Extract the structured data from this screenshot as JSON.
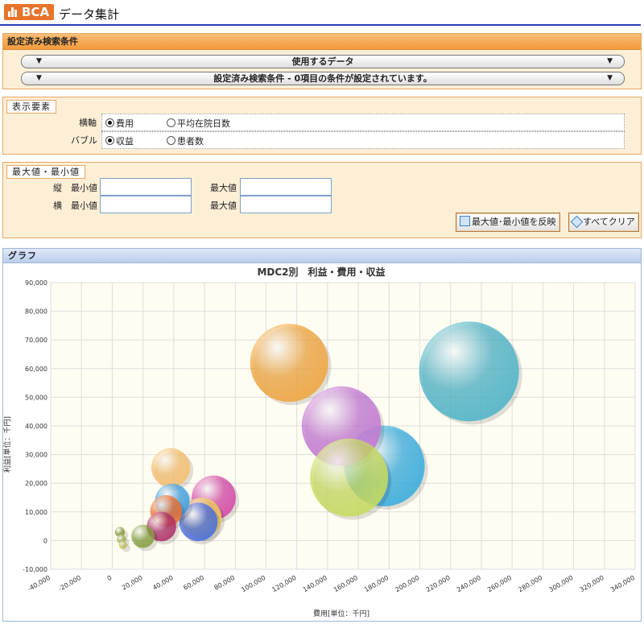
{
  "header": {
    "logo_text": "BCA",
    "title": "データ集計",
    "accent": "#e8742a",
    "rule_color": "#2a3fb8"
  },
  "search_panel": {
    "title": "設定済み検索条件",
    "data_bar": {
      "label": "使用するデータ",
      "arrow": "▼"
    },
    "condition_bar": {
      "label": "設定済み検索条件 - 0項目の条件が設定されています。",
      "arrow": "▼"
    }
  },
  "display_panel": {
    "title": "表示要素",
    "xaxis": {
      "label": "横軸",
      "options": [
        "費用",
        "平均在院日数"
      ],
      "selected": "費用"
    },
    "bubble": {
      "label": "バブル",
      "options": [
        "収益",
        "患者数"
      ],
      "selected": "収益"
    }
  },
  "minmax_panel": {
    "title": "最大値・最小値",
    "vertical": {
      "label": "縦",
      "min_label": "最小値",
      "max_label": "最大値",
      "min_value": "",
      "max_value": ""
    },
    "horizontal": {
      "label": "横",
      "min_label": "最小値",
      "max_label": "最大値",
      "min_value": "",
      "max_value": ""
    },
    "apply_button": "最大値･最小値を反映",
    "clear_button": "すべてクリア"
  },
  "graph_panel": {
    "title": "グラフ"
  },
  "chart_data": {
    "type": "scatter",
    "title": "MDC2別　利益・費用・収益",
    "xlabel": "費用[単位：千円]",
    "ylabel": "利益[単位：千円]",
    "xlim": [
      -40000,
      340000
    ],
    "ylim": [
      -10000,
      90000
    ],
    "xticks": [
      "-40,000",
      "-20,000",
      "0",
      "20,000",
      "40,000",
      "60,000",
      "80,000",
      "100,000",
      "120,000",
      "140,000",
      "160,000",
      "180,000",
      "200,000",
      "220,000",
      "240,000",
      "260,000",
      "280,000",
      "300,000",
      "320,000",
      "340,000"
    ],
    "yticks": [
      "-10,000",
      "0",
      "10,000",
      "20,000",
      "30,000",
      "40,000",
      "50,000",
      "60,000",
      "70,000",
      "80,000",
      "90,000"
    ],
    "grid": true,
    "bubbles": [
      {
        "x": 232000,
        "y": 59000,
        "size": 298000,
        "color": "#4fb5c9"
      },
      {
        "x": 115000,
        "y": 62000,
        "size": 182000,
        "color": "#f0a640"
      },
      {
        "x": 177000,
        "y": 26000,
        "size": 194000,
        "color": "#3aaee0"
      },
      {
        "x": 149000,
        "y": 40000,
        "size": 188000,
        "color": "#c478d4"
      },
      {
        "x": 154000,
        "y": 22000,
        "size": 182000,
        "color": "#c8dc60"
      },
      {
        "x": 66000,
        "y": 15000,
        "size": 58000,
        "color": "#d64aa8"
      },
      {
        "x": 58000,
        "y": 8000,
        "size": 48000,
        "color": "#f2d060"
      },
      {
        "x": 56000,
        "y": 6500,
        "size": 44000,
        "color": "#4a6fe0"
      },
      {
        "x": 38000,
        "y": 25500,
        "size": 45000,
        "color": "#f5c070"
      },
      {
        "x": 39000,
        "y": 13800,
        "size": 36000,
        "color": "#3f9fe0"
      },
      {
        "x": 35000,
        "y": 10300,
        "size": 30000,
        "color": "#f07030"
      },
      {
        "x": 32000,
        "y": 4900,
        "size": 26000,
        "color": "#b0306a"
      },
      {
        "x": 20000,
        "y": 1500,
        "size": 16000,
        "color": "#86a040"
      },
      {
        "x": 5000,
        "y": 3000,
        "size": 3000,
        "color": "#8a9a40"
      },
      {
        "x": 6000,
        "y": 500,
        "size": 2500,
        "color": "#a0b050"
      },
      {
        "x": 7000,
        "y": -1500,
        "size": 2000,
        "color": "#c0c060"
      }
    ]
  }
}
